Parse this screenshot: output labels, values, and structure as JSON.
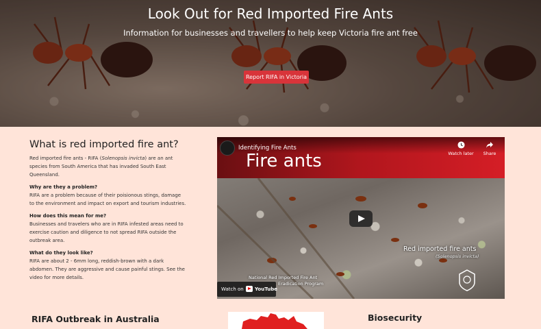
{
  "hero": {
    "title": "Look Out for Red Imported Fire Ants",
    "subtitle": "Information for businesses and travellers to help keep Victoria fire ant free",
    "button_label": "Report RIFA in Victoria",
    "button_color": "#d8343a"
  },
  "about": {
    "heading": "What is red imported fire ant?",
    "intro_prefix": "Red imported fire ants - RIFA (",
    "intro_italic": "Solenopsis invicta",
    "intro_suffix": ") are an ant species from South America that has invaded South East Queensland.",
    "sections": [
      {
        "question": "Why are they a problem?",
        "answer": "RIFA are a problem because of their poisionous stings, damage to the environment and impact on export and tourism industries."
      },
      {
        "question": "How does this mean for me?",
        "answer": "Businesses and travelers who are in RIFA infested areas need to exercise caution and diligence to not spread RIFA outside the outbreak area."
      },
      {
        "question": "What do they look like?",
        "answer": "RIFA are about 2 - 6mm long, reddish-brown with a dark abdomen. They are aggressive and cause painful stings. See the video for more details."
      }
    ]
  },
  "video": {
    "title": "Identifying Fire Ants",
    "big_text": "Fire ants",
    "watch_later": "Watch later",
    "share": "Share",
    "caption_main": "Red imported fire ants",
    "caption_sub": "(Solenopsis invicta)",
    "program_line1": "National Red Imported Fire Ant",
    "program_line2": "Eradication Program",
    "watch_on": "Watch on",
    "youtube": "YouTube"
  },
  "bottom": {
    "outbreak_heading": "RIFA Outbreak in Australia",
    "biosecurity_heading": "Biosecurity",
    "map_color": "#e02020"
  }
}
